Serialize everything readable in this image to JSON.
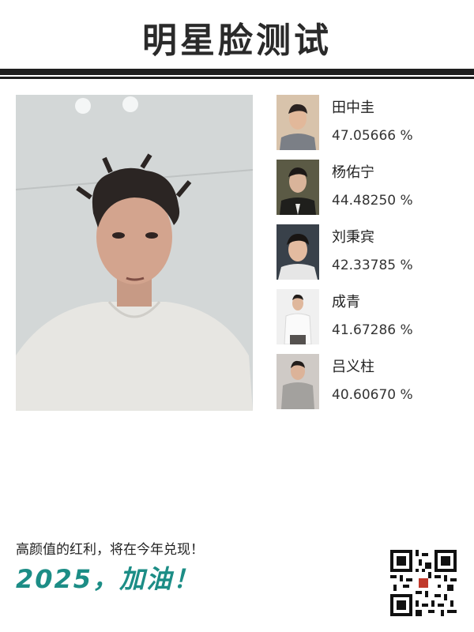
{
  "title": "明星脸测试",
  "matches": [
    {
      "name": "田中圭",
      "score": "47.05666 %"
    },
    {
      "name": "杨佑宁",
      "score": "44.48250 %"
    },
    {
      "name": "刘秉宾",
      "score": "42.33785 %"
    },
    {
      "name": "成青",
      "score": "41.67286 %"
    },
    {
      "name": "吕义柱",
      "score": "40.60670 %"
    }
  ],
  "footer": {
    "slogan": "高颜值的红利，将在今年兑现！",
    "cheer": "2025，加油！"
  },
  "colors": {
    "accent": "#1c8d86",
    "title": "#2a2a2a",
    "rule": "#1e1e1e"
  },
  "icons": {
    "qr": "qr-code-icon"
  }
}
